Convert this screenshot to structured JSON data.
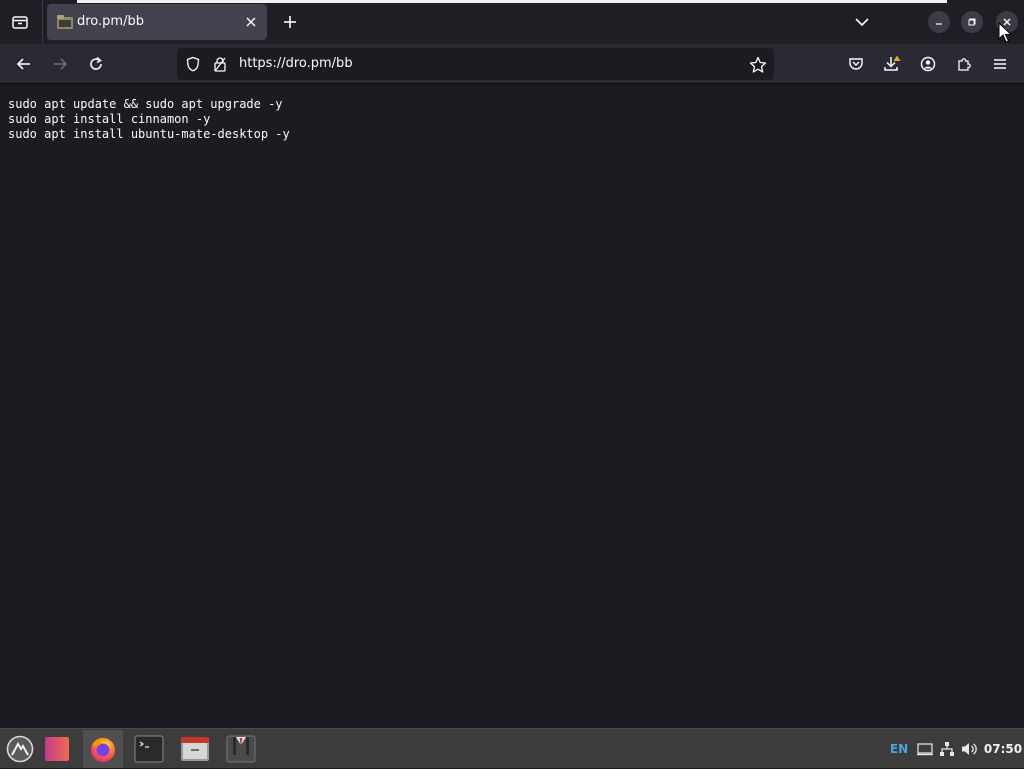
{
  "browser": {
    "tab": {
      "title": "dro.pm/bb"
    },
    "urlbar": {
      "url": "https://dro.pm/bb"
    }
  },
  "page": {
    "lines": [
      "sudo apt update && sudo apt upgrade -y",
      "sudo apt install cinnamon -y",
      "sudo apt install ubuntu-mate-desktop -y"
    ]
  },
  "taskbar": {
    "language": "EN",
    "clock": "07:50"
  },
  "colors": {
    "page_background": "#1c1b22",
    "toolbar": "#2b2a33",
    "tab_active": "#42414d",
    "language_indicator": "#4aa3df"
  },
  "icons": {
    "tab_list": "tab-list-icon",
    "favicon": "folder-icon",
    "tab_close": "close-icon",
    "new_tab": "plus-icon",
    "list_all_tabs": "chevron-down-icon",
    "back": "arrow-left-icon",
    "forward": "arrow-right-icon",
    "reload": "reload-icon",
    "tracking_protection": "shield-icon",
    "site_security": "lock-icon",
    "bookmark": "star-icon",
    "pocket": "pocket-icon",
    "downloads": "download-icon",
    "account": "account-icon",
    "extensions": "puzzle-icon",
    "menu": "hamburger-menu-icon",
    "taskbar_menu": "mountain-logo-icon",
    "taskbar_apps": [
      "app-launcher-icon",
      "firefox-icon",
      "terminal-icon",
      "file-manager-icon",
      "password-manager-icon"
    ],
    "tray": [
      "display-icon",
      "network-icon",
      "volume-icon"
    ]
  }
}
